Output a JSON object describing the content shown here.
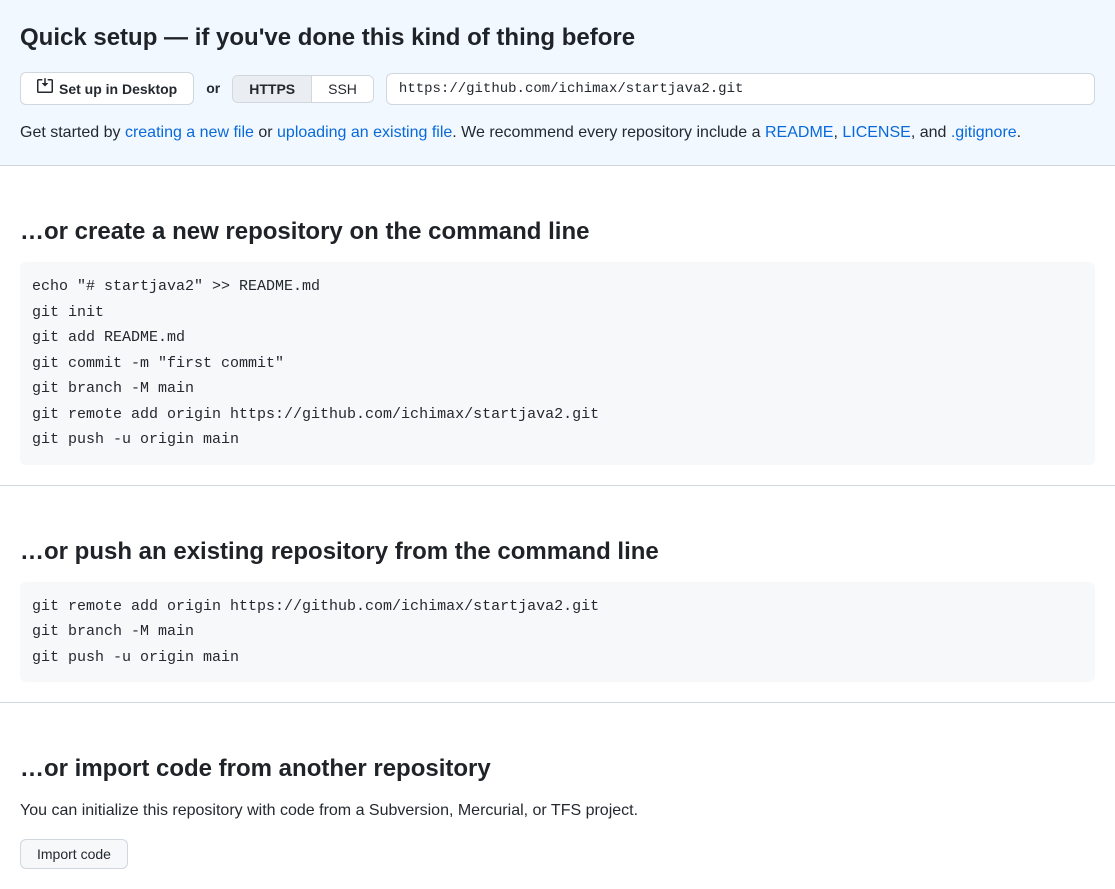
{
  "quickSetup": {
    "title": "Quick setup — if you've done this kind of thing before",
    "desktopButton": "Set up in Desktop",
    "orText": "or",
    "protocolHttps": "HTTPS",
    "protocolSsh": "SSH",
    "cloneUrl": "https://github.com/ichimax/startjava2.git",
    "getStartedPrefix": "Get started by ",
    "createNewFile": "creating a new file",
    "orText2": " or ",
    "uploadExisting": "uploading an existing file",
    "recommend": ". We recommend every repository include a ",
    "readme": "README",
    "comma": ", ",
    "license": "LICENSE",
    "and": ", and ",
    "gitignore": ".gitignore",
    "period": "."
  },
  "sectionCreate": {
    "title": "…or create a new repository on the command line",
    "code": "echo \"# startjava2\" >> README.md\ngit init\ngit add README.md\ngit commit -m \"first commit\"\ngit branch -M main\ngit remote add origin https://github.com/ichimax/startjava2.git\ngit push -u origin main"
  },
  "sectionPush": {
    "title": "…or push an existing repository from the command line",
    "code": "git remote add origin https://github.com/ichimax/startjava2.git\ngit branch -M main\ngit push -u origin main"
  },
  "sectionImport": {
    "title": "…or import code from another repository",
    "description": "You can initialize this repository with code from a Subversion, Mercurial, or TFS project.",
    "button": "Import code"
  }
}
